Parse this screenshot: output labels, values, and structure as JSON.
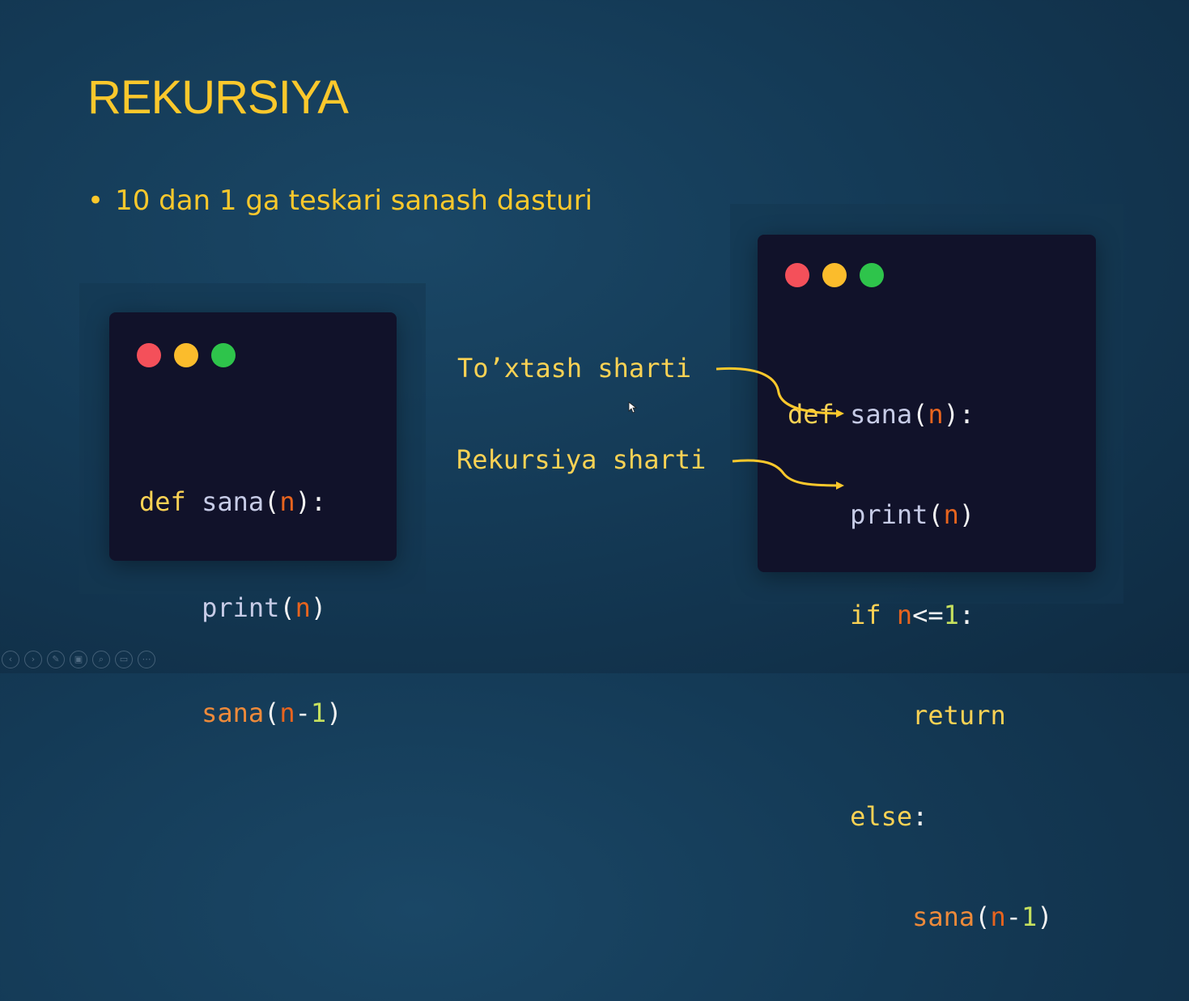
{
  "slide": {
    "title": "REKURSIYA",
    "bullet_marker": "•",
    "bullet_text": "10 dan 1 ga teskari sanash dasturi"
  },
  "left_code": {
    "line1": {
      "kw": "def",
      "fn": "sana",
      "open": "(",
      "arg": "n",
      "close": "):"
    },
    "line2": {
      "fn": "print",
      "open": "(",
      "arg": "n",
      "close": ")"
    },
    "line3": {
      "fn": "sana",
      "open": "(",
      "arg": "n",
      "op": "-",
      "num": "1",
      "close": ")"
    }
  },
  "right_code": {
    "line1": {
      "kw": "def",
      "fn": "sana",
      "open": "(",
      "arg": "n",
      "close": "):"
    },
    "line2": {
      "fn": "print",
      "open": "(",
      "arg": "n",
      "close": ")"
    },
    "line3": {
      "kw": "if",
      "arg": "n",
      "op": "<=",
      "num": "1",
      "close": ":"
    },
    "line4": {
      "kw": "return"
    },
    "line5": {
      "kw": "else",
      "close": ":"
    },
    "line6": {
      "fn": "sana",
      "open": "(",
      "arg": "n",
      "op": "-",
      "num": "1",
      "close": ")"
    }
  },
  "annotations": {
    "stop_condition": "To’xtash sharti",
    "recursion_condition": "Rekursiya sharti"
  },
  "toolbar": {
    "buttons": [
      "prev-icon",
      "next-icon",
      "pen-icon",
      "slides-icon",
      "zoom-icon",
      "subtitles-icon",
      "more-icon"
    ],
    "glyphs": [
      "‹",
      "›",
      "✎",
      "▣",
      "⌕",
      "▭",
      "⋯"
    ]
  },
  "colors": {
    "title": "#fbc82c",
    "code_bg": "#11122a",
    "keyword": "#fbd254",
    "variable": "#e8641e",
    "number": "#c6e05e",
    "arrow": "#fbc82c"
  }
}
